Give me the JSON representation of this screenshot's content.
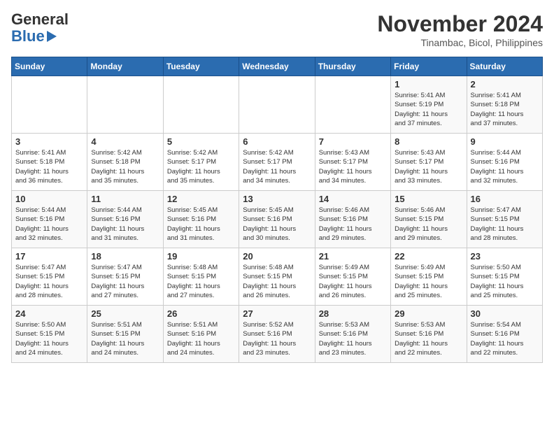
{
  "header": {
    "logo_line1": "General",
    "logo_line2": "Blue",
    "month": "November 2024",
    "location": "Tinambac, Bicol, Philippines"
  },
  "days_of_week": [
    "Sunday",
    "Monday",
    "Tuesday",
    "Wednesday",
    "Thursday",
    "Friday",
    "Saturday"
  ],
  "weeks": [
    [
      {
        "day": "",
        "info": ""
      },
      {
        "day": "",
        "info": ""
      },
      {
        "day": "",
        "info": ""
      },
      {
        "day": "",
        "info": ""
      },
      {
        "day": "",
        "info": ""
      },
      {
        "day": "1",
        "info": "Sunrise: 5:41 AM\nSunset: 5:19 PM\nDaylight: 11 hours\nand 37 minutes."
      },
      {
        "day": "2",
        "info": "Sunrise: 5:41 AM\nSunset: 5:18 PM\nDaylight: 11 hours\nand 37 minutes."
      }
    ],
    [
      {
        "day": "3",
        "info": "Sunrise: 5:41 AM\nSunset: 5:18 PM\nDaylight: 11 hours\nand 36 minutes."
      },
      {
        "day": "4",
        "info": "Sunrise: 5:42 AM\nSunset: 5:18 PM\nDaylight: 11 hours\nand 35 minutes."
      },
      {
        "day": "5",
        "info": "Sunrise: 5:42 AM\nSunset: 5:17 PM\nDaylight: 11 hours\nand 35 minutes."
      },
      {
        "day": "6",
        "info": "Sunrise: 5:42 AM\nSunset: 5:17 PM\nDaylight: 11 hours\nand 34 minutes."
      },
      {
        "day": "7",
        "info": "Sunrise: 5:43 AM\nSunset: 5:17 PM\nDaylight: 11 hours\nand 34 minutes."
      },
      {
        "day": "8",
        "info": "Sunrise: 5:43 AM\nSunset: 5:17 PM\nDaylight: 11 hours\nand 33 minutes."
      },
      {
        "day": "9",
        "info": "Sunrise: 5:44 AM\nSunset: 5:16 PM\nDaylight: 11 hours\nand 32 minutes."
      }
    ],
    [
      {
        "day": "10",
        "info": "Sunrise: 5:44 AM\nSunset: 5:16 PM\nDaylight: 11 hours\nand 32 minutes."
      },
      {
        "day": "11",
        "info": "Sunrise: 5:44 AM\nSunset: 5:16 PM\nDaylight: 11 hours\nand 31 minutes."
      },
      {
        "day": "12",
        "info": "Sunrise: 5:45 AM\nSunset: 5:16 PM\nDaylight: 11 hours\nand 31 minutes."
      },
      {
        "day": "13",
        "info": "Sunrise: 5:45 AM\nSunset: 5:16 PM\nDaylight: 11 hours\nand 30 minutes."
      },
      {
        "day": "14",
        "info": "Sunrise: 5:46 AM\nSunset: 5:16 PM\nDaylight: 11 hours\nand 29 minutes."
      },
      {
        "day": "15",
        "info": "Sunrise: 5:46 AM\nSunset: 5:15 PM\nDaylight: 11 hours\nand 29 minutes."
      },
      {
        "day": "16",
        "info": "Sunrise: 5:47 AM\nSunset: 5:15 PM\nDaylight: 11 hours\nand 28 minutes."
      }
    ],
    [
      {
        "day": "17",
        "info": "Sunrise: 5:47 AM\nSunset: 5:15 PM\nDaylight: 11 hours\nand 28 minutes."
      },
      {
        "day": "18",
        "info": "Sunrise: 5:47 AM\nSunset: 5:15 PM\nDaylight: 11 hours\nand 27 minutes."
      },
      {
        "day": "19",
        "info": "Sunrise: 5:48 AM\nSunset: 5:15 PM\nDaylight: 11 hours\nand 27 minutes."
      },
      {
        "day": "20",
        "info": "Sunrise: 5:48 AM\nSunset: 5:15 PM\nDaylight: 11 hours\nand 26 minutes."
      },
      {
        "day": "21",
        "info": "Sunrise: 5:49 AM\nSunset: 5:15 PM\nDaylight: 11 hours\nand 26 minutes."
      },
      {
        "day": "22",
        "info": "Sunrise: 5:49 AM\nSunset: 5:15 PM\nDaylight: 11 hours\nand 25 minutes."
      },
      {
        "day": "23",
        "info": "Sunrise: 5:50 AM\nSunset: 5:15 PM\nDaylight: 11 hours\nand 25 minutes."
      }
    ],
    [
      {
        "day": "24",
        "info": "Sunrise: 5:50 AM\nSunset: 5:15 PM\nDaylight: 11 hours\nand 24 minutes."
      },
      {
        "day": "25",
        "info": "Sunrise: 5:51 AM\nSunset: 5:15 PM\nDaylight: 11 hours\nand 24 minutes."
      },
      {
        "day": "26",
        "info": "Sunrise: 5:51 AM\nSunset: 5:16 PM\nDaylight: 11 hours\nand 24 minutes."
      },
      {
        "day": "27",
        "info": "Sunrise: 5:52 AM\nSunset: 5:16 PM\nDaylight: 11 hours\nand 23 minutes."
      },
      {
        "day": "28",
        "info": "Sunrise: 5:53 AM\nSunset: 5:16 PM\nDaylight: 11 hours\nand 23 minutes."
      },
      {
        "day": "29",
        "info": "Sunrise: 5:53 AM\nSunset: 5:16 PM\nDaylight: 11 hours\nand 22 minutes."
      },
      {
        "day": "30",
        "info": "Sunrise: 5:54 AM\nSunset: 5:16 PM\nDaylight: 11 hours\nand 22 minutes."
      }
    ]
  ]
}
